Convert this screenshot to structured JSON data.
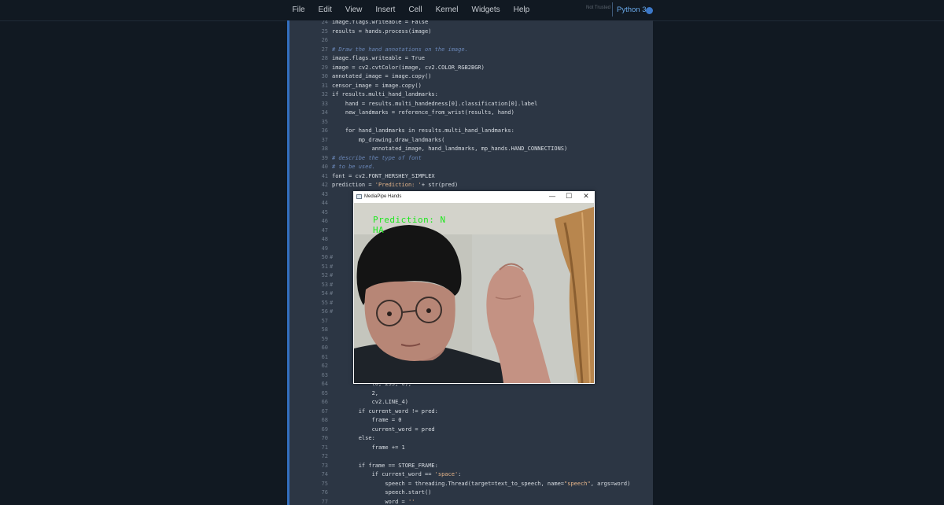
{
  "menubar": {
    "items": [
      "File",
      "Edit",
      "View",
      "Insert",
      "Cell",
      "Kernel",
      "Widgets",
      "Help"
    ],
    "trust_status": "Not Trusted",
    "kernel_name": "Python 3",
    "kernel_indicator_color": "#3c78c8"
  },
  "editor": {
    "lines": [
      {
        "n": "24",
        "t": "image.flags.writeable = False",
        "k": "code"
      },
      {
        "n": "25",
        "t": "results = hands.process(image)",
        "k": "code"
      },
      {
        "n": "26",
        "t": "",
        "k": "code"
      },
      {
        "n": "27",
        "t": "# Draw the hand annotations on the image.",
        "k": "com"
      },
      {
        "n": "28",
        "t": "image.flags.writeable = True",
        "k": "code"
      },
      {
        "n": "29",
        "t": "image = cv2.cvtColor(image, cv2.COLOR_RGB2BGR)",
        "k": "code"
      },
      {
        "n": "30",
        "t": "annotated_image = image.copy()",
        "k": "code"
      },
      {
        "n": "31",
        "t": "censor_image = image.copy()",
        "k": "code"
      },
      {
        "n": "32",
        "t": "if results.multi_hand_landmarks:",
        "k": "code"
      },
      {
        "n": "33",
        "t": "    hand = results.multi_handedness[0].classification[0].label",
        "k": "code"
      },
      {
        "n": "34",
        "t": "    new_landmarks = reference_from_wrist(results, hand)",
        "k": "code"
      },
      {
        "n": "35",
        "t": "",
        "k": "code"
      },
      {
        "n": "36",
        "t": "    for hand_landmarks in results.multi_hand_landmarks:",
        "k": "code"
      },
      {
        "n": "37",
        "t": "        mp_drawing.draw_landmarks(",
        "k": "code"
      },
      {
        "n": "38",
        "t": "            annotated_image, hand_landmarks, mp_hands.HAND_CONNECTIONS)",
        "k": "code"
      },
      {
        "n": "39",
        "t": "# describe the type of font",
        "k": "com"
      },
      {
        "n": "40",
        "t": "# to be used.",
        "k": "com"
      },
      {
        "n": "41",
        "t": "font = cv2.FONT_HERSHEY_SIMPLEX",
        "k": "code"
      },
      {
        "n": "42",
        "t": "prediction = 'Prediction: '+ str(pred)",
        "k": "code"
      },
      {
        "n": "43",
        "t": "",
        "k": "code"
      },
      {
        "n": "44",
        "t": "",
        "k": "code"
      },
      {
        "n": "45",
        "t": "",
        "k": "code"
      },
      {
        "n": "46",
        "t": "",
        "k": "code"
      },
      {
        "n": "47",
        "t": "",
        "k": "code"
      },
      {
        "n": "48",
        "t": "",
        "k": "code"
      },
      {
        "n": "49",
        "t": "",
        "k": "code"
      },
      {
        "n": "50",
        "t": "#",
        "k": "hash"
      },
      {
        "n": "51",
        "t": "#",
        "k": "hash"
      },
      {
        "n": "52",
        "t": "#",
        "k": "hash"
      },
      {
        "n": "53",
        "t": "#",
        "k": "hash"
      },
      {
        "n": "54",
        "t": "#",
        "k": "hash"
      },
      {
        "n": "55",
        "t": "#",
        "k": "hash"
      },
      {
        "n": "56",
        "t": "#",
        "k": "hash"
      },
      {
        "n": "57",
        "t": "",
        "k": "code"
      },
      {
        "n": "58",
        "t": "",
        "k": "code"
      },
      {
        "n": "59",
        "t": "",
        "k": "code"
      },
      {
        "n": "60",
        "t": "",
        "k": "code"
      },
      {
        "n": "61",
        "t": "",
        "k": "code"
      },
      {
        "n": "62",
        "t": "",
        "k": "code"
      },
      {
        "n": "63",
        "t": "",
        "k": "code"
      },
      {
        "n": "64",
        "t": "            (0, 255, 0),",
        "k": "code"
      },
      {
        "n": "65",
        "t": "            2,",
        "k": "code"
      },
      {
        "n": "66",
        "t": "            cv2.LINE_4)",
        "k": "code"
      },
      {
        "n": "67",
        "t": "        if current_word != pred:",
        "k": "code"
      },
      {
        "n": "68",
        "t": "            frame = 0",
        "k": "code"
      },
      {
        "n": "69",
        "t": "            current_word = pred",
        "k": "code"
      },
      {
        "n": "70",
        "t": "        else:",
        "k": "code"
      },
      {
        "n": "71",
        "t": "            frame += 1",
        "k": "code"
      },
      {
        "n": "72",
        "t": "",
        "k": "code"
      },
      {
        "n": "73",
        "t": "        if frame == STORE_FRAME:",
        "k": "code"
      },
      {
        "n": "74",
        "t": "            if current_word == 'space':",
        "k": "code"
      },
      {
        "n": "75",
        "t": "                speech = threading.Thread(target=text_to_speech, name=\"speech\", args=word)",
        "k": "code"
      },
      {
        "n": "76",
        "t": "                speech.start()",
        "k": "code"
      },
      {
        "n": "77",
        "t": "                word = ''",
        "k": "code"
      }
    ]
  },
  "window": {
    "title": "MediaPipe Hands",
    "min_glyph": "—",
    "max_glyph": "☐",
    "close_glyph": "✕",
    "overlay_prediction": "Prediction: N",
    "overlay_word": "HA"
  }
}
